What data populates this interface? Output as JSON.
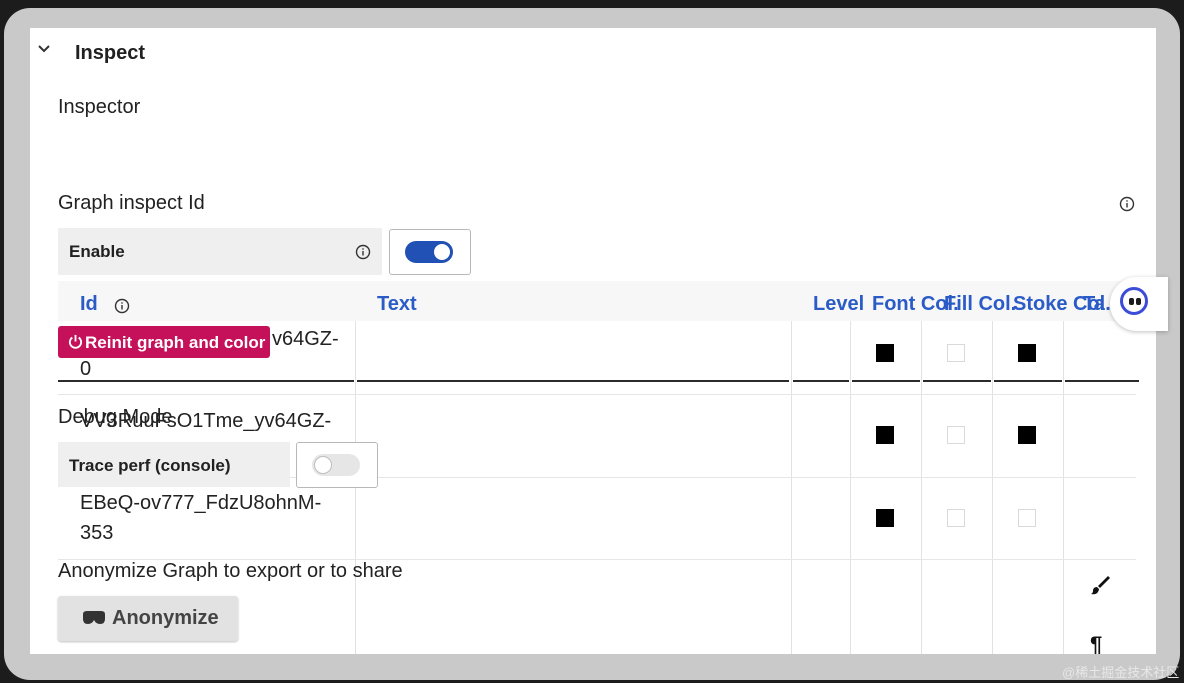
{
  "section": {
    "title": "Inspect",
    "toggle_icon": "chevron-down-icon"
  },
  "inspector": {
    "label": "Inspector"
  },
  "graph_inspect": {
    "label": "Graph inspect Id",
    "info_icon": "info-icon",
    "enable": {
      "label": "Enable",
      "state": true,
      "info_icon": "info-icon"
    }
  },
  "table": {
    "headers": {
      "id": "Id",
      "text": "Text",
      "level": "Level",
      "font_color": "Font Col.",
      "fill_color": "Fill Col.",
      "stroke_color": "Stoke Col.",
      "ta": "Ta"
    },
    "rows": [
      {
        "id_line1": "v64GZ-",
        "id_line2": "0",
        "font": "black",
        "fill": "white",
        "stroke": "black"
      },
      {
        "id_line1": "VV3RuuFsO1Tme_yv64GZ-",
        "id_line2": "",
        "font": "black",
        "fill": "white",
        "stroke": "black"
      },
      {
        "id_line1": "EBeQ-ov777_FdzU8ohnM-",
        "id_line2": "353",
        "font": "black",
        "fill": "white",
        "stroke": "white"
      }
    ]
  },
  "reinit_button": {
    "label": "Reinit graph and color",
    "icon": "power-icon"
  },
  "debug": {
    "label": "Debug Mode",
    "trace": {
      "label": "Trace perf (console)",
      "state": false
    }
  },
  "anonymize": {
    "description": "Anonymize Graph to export or to share",
    "button_label": "Anonymize",
    "icon": "mask-icon"
  },
  "side_tools": {
    "brush_icon": "paintbrush-icon",
    "paragraph_symbol": "¶"
  },
  "watermark": "@稀土掘金技术社区",
  "colors": {
    "accent_blue": "#2251b6",
    "header_blue": "#2a5bc7",
    "reinit_pink": "#c5105a"
  }
}
